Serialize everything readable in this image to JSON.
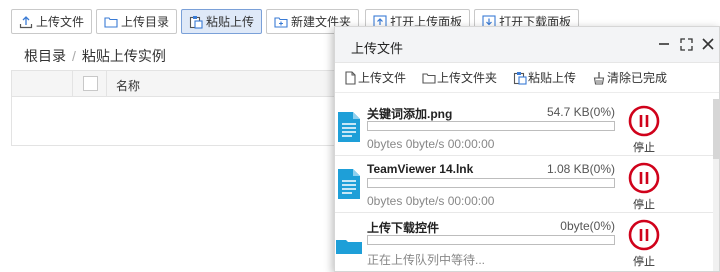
{
  "toolbar": {
    "upload_file": "上传文件",
    "upload_folder": "上传目录",
    "paste_upload": "粘贴上传",
    "new_folder": "新建文件夹",
    "open_upload_panel": "打开上传面板",
    "open_download_panel": "打开下载面板"
  },
  "breadcrumb": {
    "root": "根目录",
    "separator": "/",
    "current": "粘贴上传实例"
  },
  "grid": {
    "col_name": "名称"
  },
  "panel": {
    "title": "上传文件",
    "tools": {
      "upload_file": "上传文件",
      "upload_folder": "上传文件夹",
      "paste_upload": "粘贴上传",
      "clear_done": "清除已完成"
    },
    "items": [
      {
        "name": "关键词添加.png",
        "size": "54.7 KB(0%)",
        "progress": 0,
        "info": "0bytes 0byte/s 00:00:00",
        "stop": "停止",
        "icon": "file-icon"
      },
      {
        "name": "TeamViewer 14.lnk",
        "size": "1.08 KB(0%)",
        "progress": 0,
        "info": "0bytes 0byte/s 00:00:00",
        "stop": "停止",
        "icon": "file-icon"
      },
      {
        "name": "上传下载控件",
        "size": "0byte(0%)",
        "progress": 0,
        "info": "正在上传队列中等待...",
        "stop": "停止",
        "icon": "folder-icon"
      }
    ]
  },
  "colors": {
    "accent": "#1e9fd8",
    "stop": "#d0021b",
    "active_button_bg": "#dfe9f8"
  }
}
